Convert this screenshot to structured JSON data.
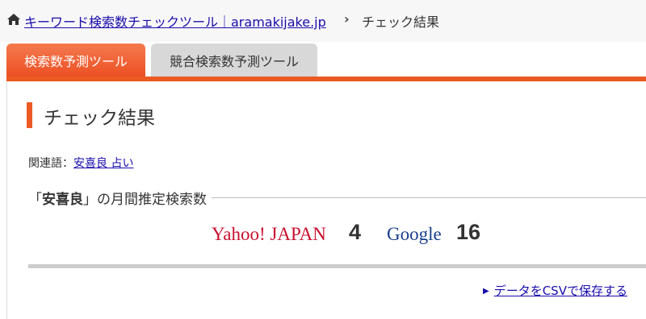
{
  "breadcrumb": {
    "home_icon": "home-icon",
    "site_link": "キーワード検索数チェックツール｜aramakijake.jp",
    "separator": "›",
    "current": "チェック結果"
  },
  "tabs": [
    {
      "label": "検索数予測ツール",
      "active": true
    },
    {
      "label": "競合検索数予測ツール",
      "active": false
    }
  ],
  "colors": {
    "accent": "#ea5a22",
    "yahoo": "#c8102e",
    "google": "#1a3f8c",
    "link": "#1a0dab"
  },
  "main": {
    "heading": "チェック結果",
    "related_label": "関連語：",
    "related_link": "安喜良 占い",
    "subheading_prefix": "「",
    "keyword": "安喜良",
    "subheading_suffix": "」の月間推定検索数",
    "yahoo_label": "Yahoo! JAPAN",
    "yahoo_count": "4",
    "google_label": "Google",
    "google_count": "16",
    "csv_link": "データをCSVで保存する"
  }
}
